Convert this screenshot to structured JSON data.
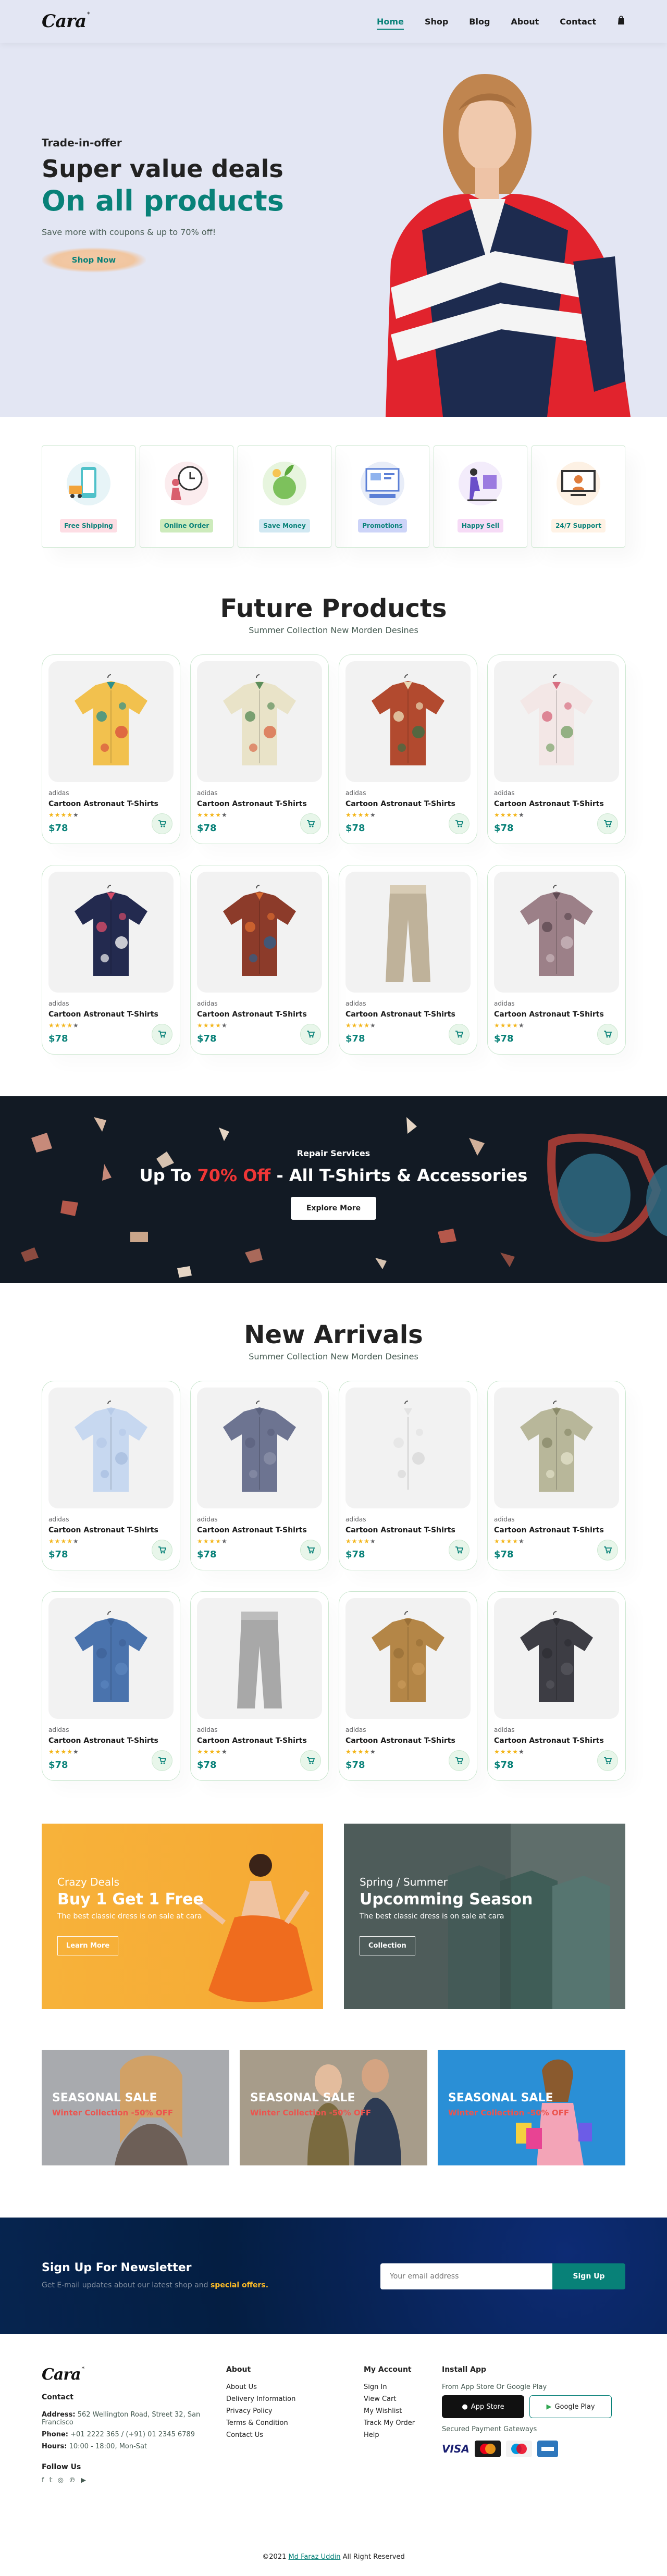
{
  "header": {
    "logo": "Cara",
    "logo_mark": "*",
    "nav": [
      "Home",
      "Shop",
      "Blog",
      "About",
      "Contact"
    ],
    "cart_icon": "bag-icon"
  },
  "hero": {
    "pre": "Trade-in-offer",
    "title": "Super value deals",
    "highlight": "On all products",
    "subtitle": "Save more with coupons & up to 70% off!",
    "button": "Shop Now"
  },
  "features": [
    {
      "label": "Free Shipping",
      "bg": "#fddde4"
    },
    {
      "label": "Online Order",
      "bg": "#cdebbc"
    },
    {
      "label": "Save Money",
      "bg": "#d1e8f2"
    },
    {
      "label": "Promotions",
      "bg": "#cdd4f8"
    },
    {
      "label": "Happy Sell",
      "bg": "#f6dbf6"
    },
    {
      "label": "24/7 Support",
      "bg": "#fff2e5"
    }
  ],
  "featured": {
    "title": "Future Products",
    "subtitle": "Summer Collection New Morden Desines"
  },
  "products": {
    "brand": "adidas",
    "name": "Cartoon Astronaut T-Shirts",
    "price": "$78",
    "stars": "★★★★",
    "stars_empty": "★"
  },
  "repair_banner": {
    "kicker": "Repair Services",
    "title_pre": "Up To ",
    "title_red": "70% Off",
    "title_post": " - All T-Shirts & Accessories",
    "button": "Explore More"
  },
  "arrivals": {
    "title": "New Arrivals",
    "subtitle": "Summer Collection New Morden Desines"
  },
  "promo_banners": [
    {
      "kicker": "Crazy Deals",
      "title": "Buy 1 Get 1 Free",
      "text": "The best classic dress is on sale at cara",
      "button": "Learn More"
    },
    {
      "kicker": "Spring / Summer",
      "title": "Upcomming Season",
      "text": "The best classic dress is on sale at cara",
      "button": "Collection"
    }
  ],
  "seasonal": [
    {
      "title": "SEASONAL SALE",
      "sub": "Winter Collection -50% OFF"
    },
    {
      "title": "SEASONAL SALE",
      "sub": "Winter Collection -50% OFF"
    },
    {
      "title": "SEASONAL SALE",
      "sub": "Winter Collection -50% OFF"
    }
  ],
  "newsletter": {
    "title": "Sign Up For Newsletter",
    "text_pre": "Get E-mail updates about our latest shop and ",
    "text_bold": "special offers.",
    "placeholder": "Your email address",
    "button": "Sign Up"
  },
  "footer": {
    "contact_h": "Contact",
    "address_l": "Address:",
    "address": "562 Wellington Road, Street 32, San Francisco",
    "phone_l": "Phone:",
    "phone": "+01 2222 365 / (+91) 01 2345 6789",
    "hours_l": "Hours:",
    "hours": "10:00 - 18:00, Mon-Sat",
    "follow": "Follow Us",
    "about_h": "About",
    "about_links": [
      "About Us",
      "Delivery Information",
      "Privacy Policy",
      "Terms & Condition",
      "Contact Us"
    ],
    "account_h": "My Account",
    "account_links": [
      "Sign In",
      "View Cart",
      "My Wishlist",
      "Track My Order",
      "Help"
    ],
    "install_h": "Install App",
    "install_text": "From App Store Or Google Play",
    "app_store": "App Store",
    "google_play": "Google Play",
    "gateways": "Secured Payment Gateways",
    "visa": "VISA",
    "copyright_pre": "©2021 ",
    "copyright_name": "Md Faraz Uddin",
    "copyright_post": " All Right Reserved"
  },
  "colors": {
    "accent": "#088178",
    "hero_bg": "#e3e6f3",
    "banner_bg": "#121a24",
    "newsletter_bg": "#041e42"
  }
}
